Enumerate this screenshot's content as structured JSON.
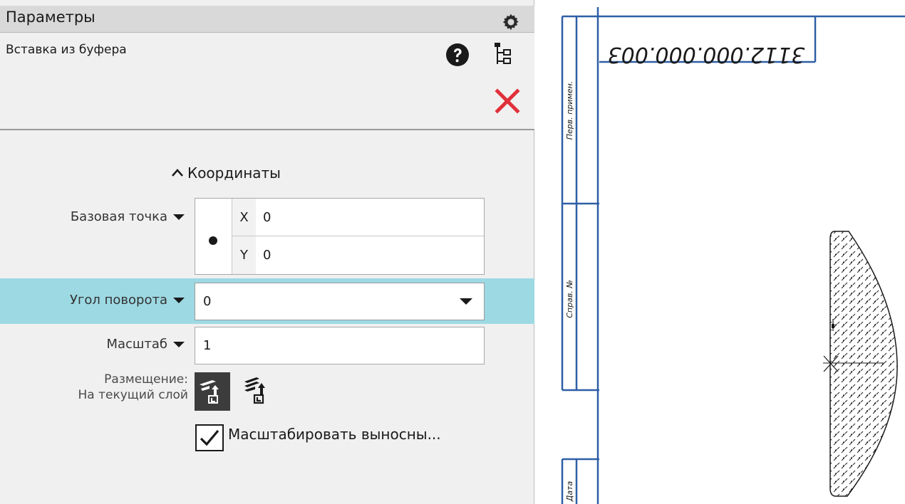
{
  "panel": {
    "title": "Параметры",
    "command_title": "Вставка из буфера",
    "section": "Координаты",
    "base_point": {
      "label": "Базовая точка",
      "x_axis": "X",
      "x_value": "0",
      "y_axis": "Y",
      "y_value": "0"
    },
    "rotation": {
      "label": "Угол поворота",
      "value": "0"
    },
    "scale": {
      "label": "Масштаб",
      "value": "1"
    },
    "placement": {
      "label": "Размещение:",
      "value": "На текущий слой"
    },
    "scale_leaders": {
      "label": "Масштабировать выносны...",
      "checked": true
    },
    "icons": [
      "gear-icon",
      "help-icon",
      "tree-icon",
      "close-icon",
      "chevron-up-icon",
      "current-layer-icon",
      "new-layer-icon",
      "checkmark-icon"
    ],
    "colors": {
      "highlight_row": "#9dd9e3",
      "close_red": "#e0303a",
      "frame_blue": "#2e5fa6"
    }
  },
  "drawing": {
    "designation": "3112.000.000.003",
    "side_labels": [
      "Перв. примен.",
      "Справ. №",
      "Дата"
    ]
  }
}
